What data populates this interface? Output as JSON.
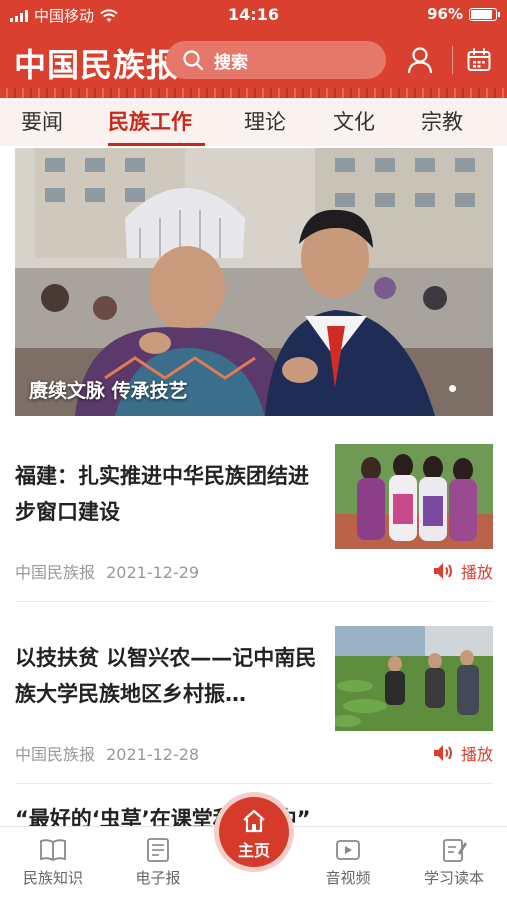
{
  "status": {
    "carrier": "中国移动",
    "time": "14:16",
    "battery_text": "96%",
    "battery_level": 0.96
  },
  "header": {
    "logo": "中国民族报",
    "search_placeholder": "搜索"
  },
  "icons": {
    "search": "search-icon",
    "user": "user-icon",
    "calendar": "calendar-icon"
  },
  "tabs": [
    {
      "label": "要闻",
      "active": false
    },
    {
      "label": "民族工作",
      "active": true
    },
    {
      "label": "理论",
      "active": false
    },
    {
      "label": "文化",
      "active": false
    },
    {
      "label": "宗教",
      "active": false
    }
  ],
  "hero": {
    "caption": "赓续文脉  传承技艺",
    "slide_index": 1
  },
  "articles": [
    {
      "title": "福建：扎实推进中华民族团结进步窗口建设",
      "source": "中国民族报",
      "date": "2021-12-29",
      "play_label": "播放"
    },
    {
      "title": "以技扶贫  以智兴农——记中南民族大学民族地区乡村振…",
      "source": "中国民族报",
      "date": "2021-12-28",
      "play_label": "播放"
    }
  ],
  "teaser_title": "“最好的‘虫草’在课堂和书本中”",
  "tabbar": {
    "items": [
      {
        "label": "民族知识",
        "icon": "book-icon"
      },
      {
        "label": "电子报",
        "icon": "newspaper-icon"
      },
      {
        "label": "主页",
        "icon": "home-icon",
        "active": true
      },
      {
        "label": "音视频",
        "icon": "video-icon"
      },
      {
        "label": "学习读本",
        "icon": "notebook-icon"
      }
    ]
  },
  "colors": {
    "brand_red": "#d9402f",
    "active_tab": "#c8291a",
    "meta_gray": "#999999"
  }
}
